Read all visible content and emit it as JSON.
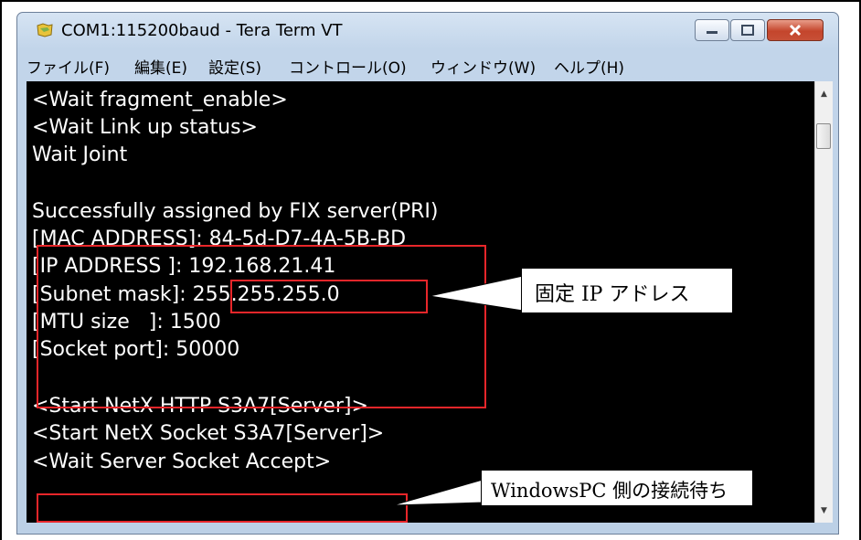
{
  "window": {
    "title": "COM1:115200baud - Tera Term VT",
    "minimize_glyph": "—",
    "maximize_glyph": "□",
    "close_glyph": "✕"
  },
  "menu": [
    {
      "label": "ファイル(F)"
    },
    {
      "label": "編集(E)"
    },
    {
      "label": "設定(S)"
    },
    {
      "label": "コントロール(O)"
    },
    {
      "label": "ウィンドウ(W)"
    },
    {
      "label": "ヘルプ(H)"
    }
  ],
  "terminal": {
    "lines": [
      "<Wait fragment_enable>",
      "<Wait Link up status>",
      "Wait Joint",
      "",
      "Successfully assigned by FIX server(PRI)",
      "[MAC ADDRESS]: 84-5d-D7-4A-5B-BD",
      "[IP ADDRESS ]: 192.168.21.41",
      "[Subnet mask]: 255.255.255.0",
      "[MTU size   ]: 1500",
      "[Socket port]: 50000",
      "",
      "<Start NetX HTTP S3A7[Server]>",
      "<Start NetX Socket S3A7[Server]>",
      "<Wait Server Socket Accept>"
    ]
  },
  "annotations": {
    "fixed_ip_label": "固定 IP アドレス",
    "wait_label": "WindowsPC 側の接続待ち"
  },
  "colors": {
    "highlight": "#e8262a",
    "terminal_bg": "#000000",
    "terminal_fg": "#ffffff"
  },
  "icons": {
    "app": "tera-term-icon",
    "scroll_up": "scroll-up-arrow-icon",
    "scroll_down": "scroll-down-arrow-icon"
  }
}
